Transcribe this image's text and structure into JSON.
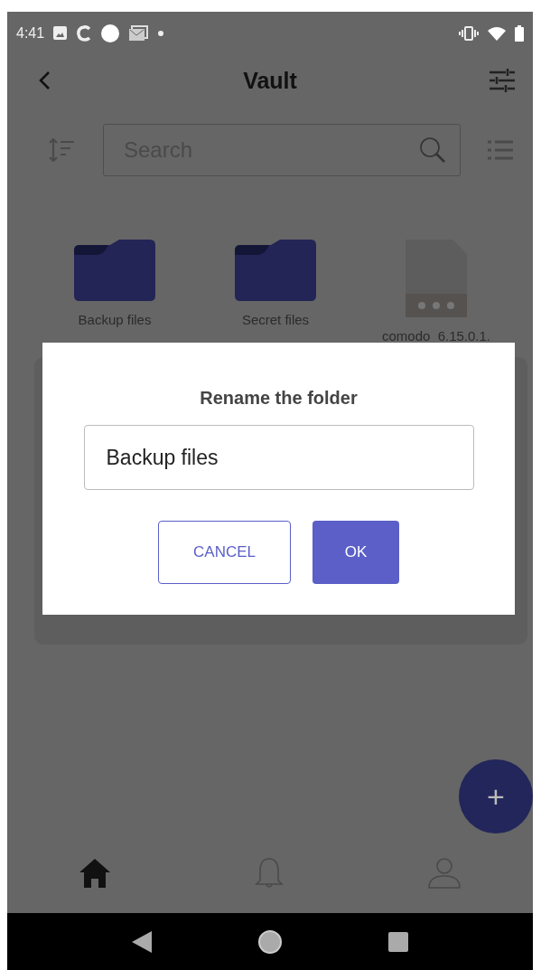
{
  "status_bar": {
    "time": "4:41"
  },
  "header": {
    "title": "Vault"
  },
  "search": {
    "placeholder": "Search"
  },
  "items": [
    {
      "kind": "folder",
      "name": "Backup files"
    },
    {
      "kind": "folder",
      "name": "Secret files"
    },
    {
      "kind": "file",
      "name": "comodo_6.15.0.1."
    }
  ],
  "dialog": {
    "title": "Rename the folder",
    "value": "Backup files",
    "buttons": [
      {
        "label": "CANCEL",
        "kind": "outline"
      },
      {
        "label": "OK",
        "kind": "filled"
      }
    ]
  },
  "fab": {
    "label": "+"
  },
  "bottom_nav": [
    {
      "kind": "home",
      "selected": true
    },
    {
      "kind": "bell",
      "selected": false
    },
    {
      "kind": "person",
      "selected": false
    }
  ]
}
